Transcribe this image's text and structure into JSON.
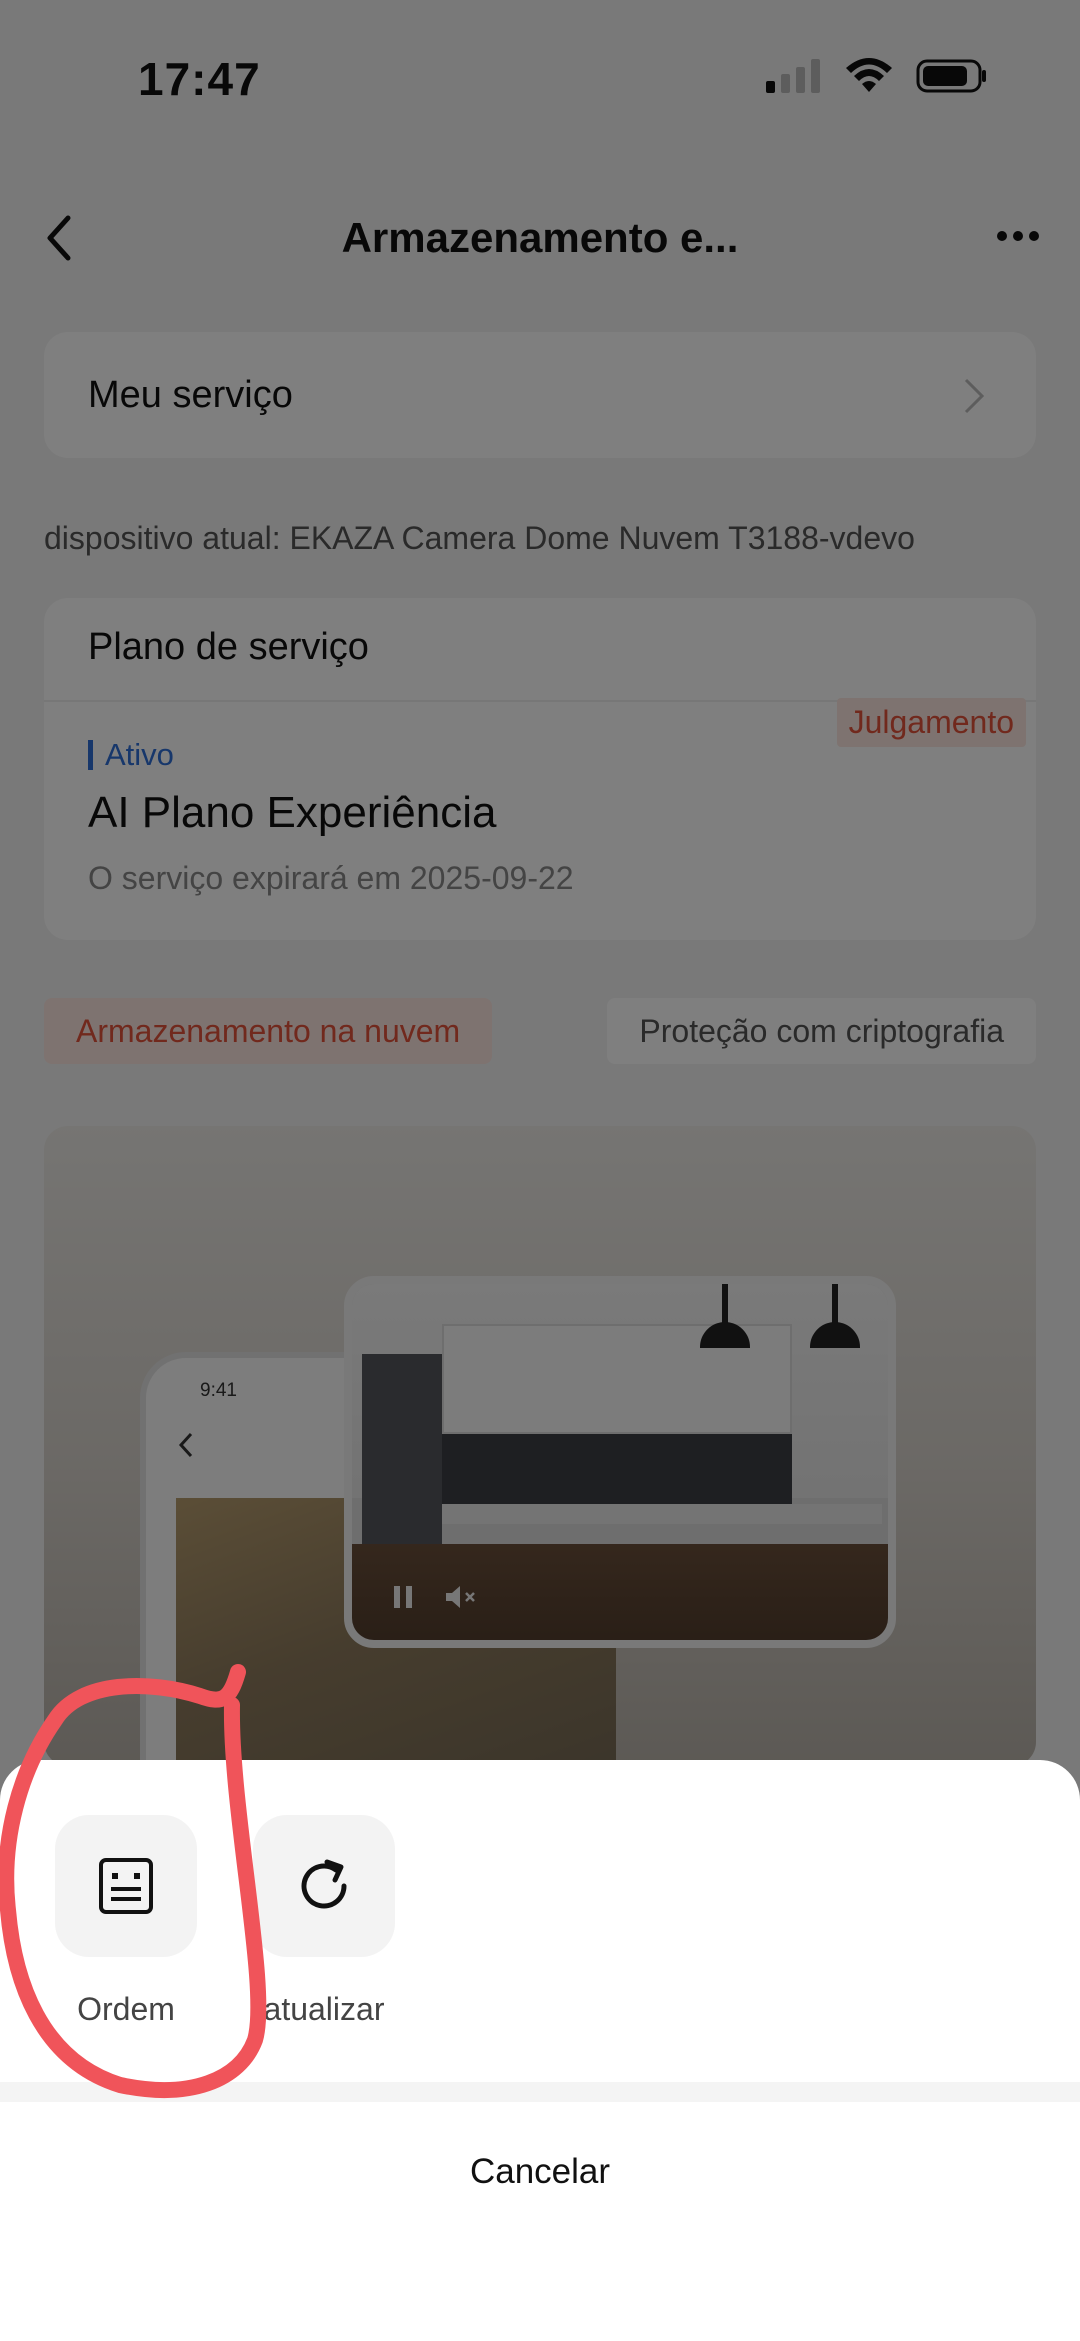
{
  "status_bar": {
    "time": "17:47"
  },
  "nav": {
    "title": "Armazenamento e..."
  },
  "my_service": {
    "label": "Meu serviço"
  },
  "device_line": "dispositivo atual: EKAZA Camera Dome Nuvem T3188-vdevo",
  "plan": {
    "title": "Plano de serviço",
    "badge": "Julgamento",
    "status": "Ativo",
    "name": "AI Plano Experiência",
    "expire": "O serviço expirará em 2025-09-22"
  },
  "tabs": {
    "active": "Armazenamento na nuvem",
    "inactive": "Proteção com criptografia"
  },
  "promo": {
    "phone_time": "9:41"
  },
  "sheet": {
    "actions": [
      {
        "label": "Ordem",
        "icon": "order-list-icon"
      },
      {
        "label": "atualizar",
        "icon": "refresh-icon"
      }
    ],
    "cancel": "Cancelar"
  },
  "colors": {
    "accent_red": "#e2523b",
    "accent_blue": "#2f6fd6",
    "annotation": "#f0545a"
  }
}
